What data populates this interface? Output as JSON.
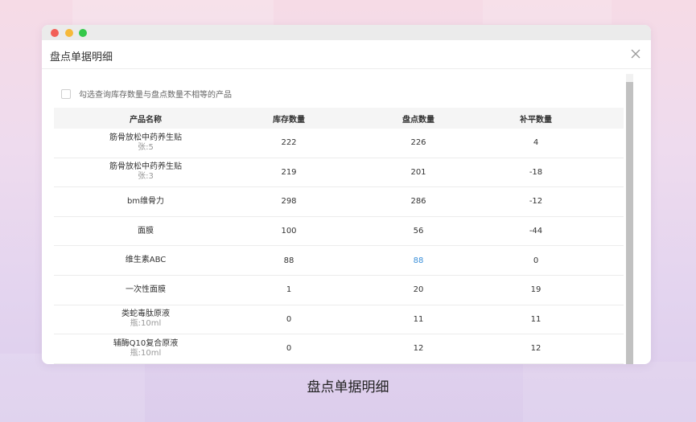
{
  "dialog": {
    "title": "盘点单据明细",
    "filter_label": "勾选查询库存数量与盘点数量不相等的产品"
  },
  "table": {
    "headers": [
      "产品名称",
      "库存数量",
      "盘点数量",
      "补平数量"
    ],
    "rows": [
      {
        "name": "筋骨放松中药养生贴",
        "unit": "张:5",
        "stock": "222",
        "counted": "226",
        "adjust": "4"
      },
      {
        "name": "筋骨放松中药养生贴",
        "unit": "张:3",
        "stock": "219",
        "counted": "201",
        "adjust": "-18"
      },
      {
        "name": "bm维骨力",
        "unit": "",
        "stock": "298",
        "counted": "286",
        "adjust": "-12"
      },
      {
        "name": "面膜",
        "unit": "",
        "stock": "100",
        "counted": "56",
        "adjust": "-44"
      },
      {
        "name": "维生素ABC",
        "unit": "",
        "stock": "88",
        "counted": "88",
        "adjust": "0",
        "counted_highlight": true
      },
      {
        "name": "一次性面膜",
        "unit": "",
        "stock": "1",
        "counted": "20",
        "adjust": "19"
      },
      {
        "name": "类蛇毒肽原液",
        "unit": "瓶:10ml",
        "stock": "0",
        "counted": "11",
        "adjust": "11"
      },
      {
        "name": "辅酶Q10复合原液",
        "unit": "瓶:10ml",
        "stock": "0",
        "counted": "12",
        "adjust": "12"
      }
    ]
  },
  "caption": "盘点单据明细",
  "colors": {
    "highlight": "#3a8fd9",
    "close_icon": "#999999"
  },
  "icons": [
    "close-icon",
    "scroll-up-arrow-icon"
  ]
}
